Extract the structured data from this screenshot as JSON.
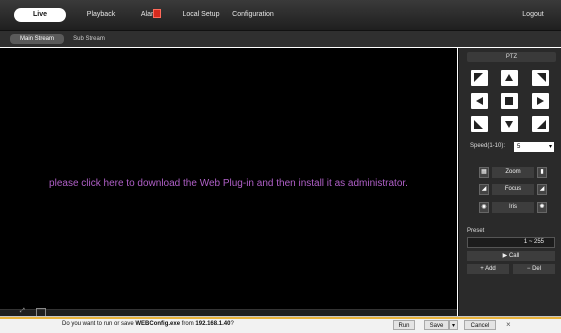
{
  "nav": {
    "live": "Live",
    "playback": "Playback",
    "alarm": "Alarm",
    "local_setup": "Local Setup",
    "configuration": "Configuration",
    "logout": "Logout"
  },
  "stream_tabs": {
    "main": "Main Stream",
    "sub": "Sub Stream"
  },
  "video": {
    "message": "please click here to download the Web Plug-in and then install it as administrator.",
    "message_color": "#b060c8"
  },
  "ptz": {
    "title": "PTZ",
    "speed_label": "Speed(1-10):",
    "speed_value": "5",
    "zoom": "Zoom",
    "focus": "Focus",
    "iris": "Iris",
    "preset_label": "Preset",
    "preset_range": "1 ~ 255",
    "call": "Call",
    "add": "Add",
    "del": "Del"
  },
  "download_bar": {
    "prefix": "Do you want to run or save ",
    "filename": "WEBConfig.exe",
    "mid": " from ",
    "host": "192.168.1.40",
    "suffix": "?",
    "run": "Run",
    "save": "Save",
    "cancel": "Cancel"
  },
  "icons": {
    "alarm": "alarm-icon",
    "arrows": [
      "up-left",
      "up",
      "up-right",
      "left",
      "center",
      "right",
      "down-left",
      "down",
      "down-right"
    ]
  }
}
